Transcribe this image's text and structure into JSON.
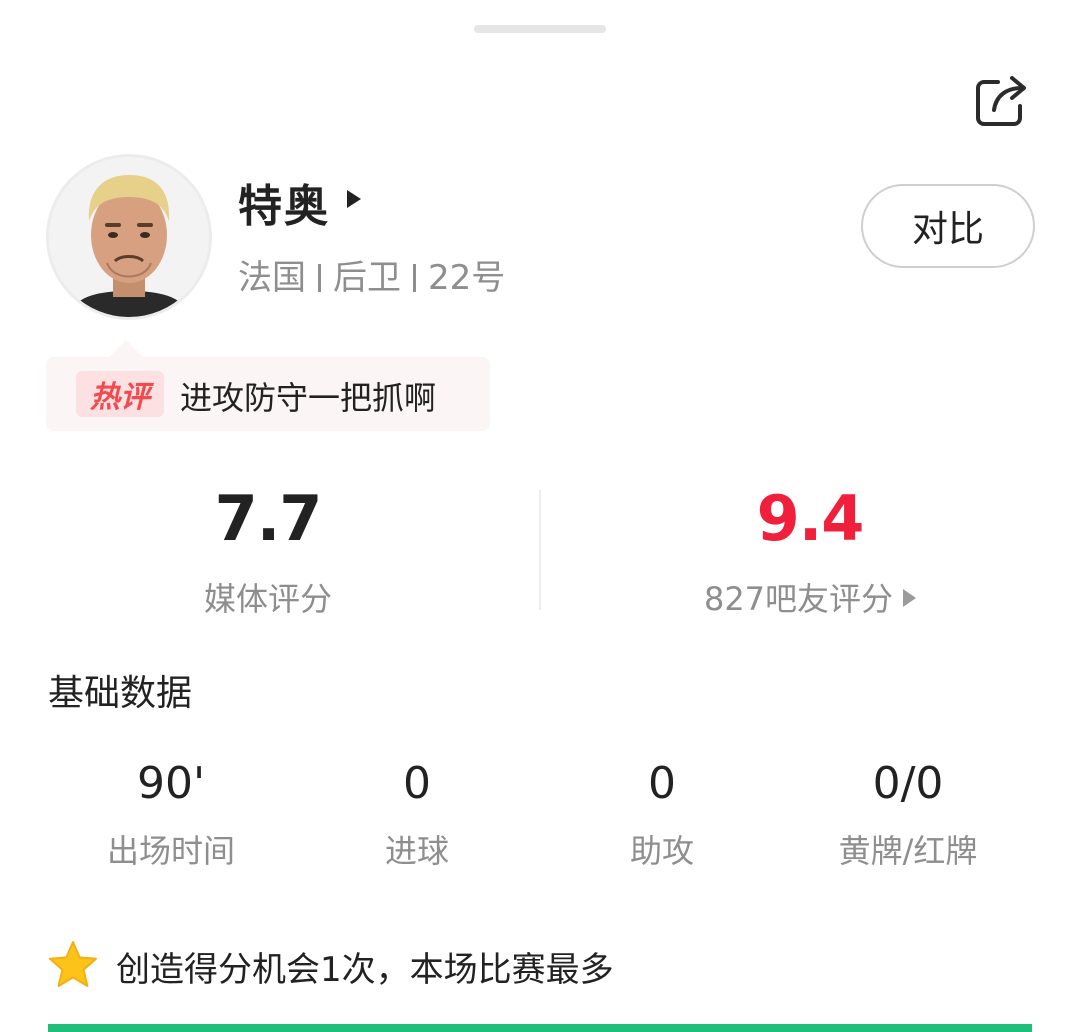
{
  "icons": {
    "share": "share-icon",
    "star": "star-icon",
    "name_arrow": "triangle-right-icon"
  },
  "colors": {
    "accent_red": "#f0203c",
    "hot_tag_red": "#f24b4f",
    "green": "#1fbf7a",
    "star_yellow": "#fcc419"
  },
  "player": {
    "name": "特奥",
    "country": "法国",
    "position": "后卫",
    "number": "22号"
  },
  "compare_label": "对比",
  "hot_comment": {
    "tag": "热评",
    "text": "进攻防守一把抓啊"
  },
  "ratings": {
    "media": {
      "value": "7.7",
      "label": "媒体评分"
    },
    "fans": {
      "value": "9.4",
      "label": "827吧友评分"
    }
  },
  "basic_stats": {
    "title": "基础数据",
    "items": [
      {
        "value": "90'",
        "label": "出场时间"
      },
      {
        "value": "0",
        "label": "进球"
      },
      {
        "value": "0",
        "label": "助攻"
      },
      {
        "value": "0/0",
        "label": "黄牌/红牌"
      }
    ]
  },
  "highlight": {
    "text": "创造得分机会1次，本场比赛最多"
  }
}
